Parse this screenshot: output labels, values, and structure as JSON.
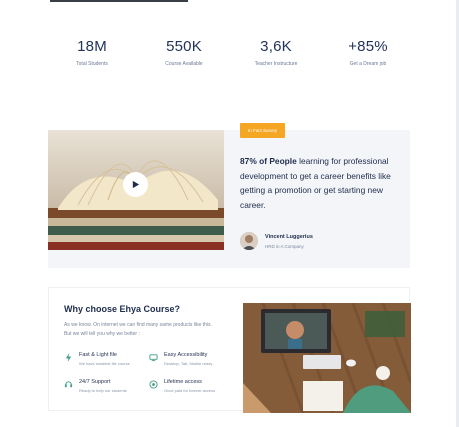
{
  "stats": [
    {
      "value": "18M",
      "label": "Total Students"
    },
    {
      "value": "550K",
      "label": "Course Available"
    },
    {
      "value": "3,6K",
      "label": "Teacher Instructure"
    },
    {
      "value": "+85%",
      "label": "Get a Dream job"
    }
  ],
  "survey": {
    "badge": "In Fact Survey",
    "highlight": "87% of People",
    "text": " learning for professional development to get a career benefits like getting a promotion or get starting new career.",
    "author_name": "Vincent Luggerius",
    "author_role": "HRD in A Company"
  },
  "why": {
    "title": "Why choose Ehya Course?",
    "description": "As we know. On internet we can find many same products like this. But we will tell you why we better :",
    "features": [
      {
        "title": "Fast & Light file",
        "sub": "We have smallest file course",
        "icon": "bolt-icon"
      },
      {
        "title": "Easy Accessibility",
        "sub": "Desktop, Tab, Mobile ready",
        "icon": "devices-icon"
      },
      {
        "title": "24/7 Support",
        "sub": "Ready to help our students",
        "icon": "headset-icon"
      },
      {
        "title": "Lifetime access",
        "sub": "Once paid for forever access",
        "icon": "infinity-icon"
      }
    ]
  },
  "colors": {
    "accent": "#f5a623",
    "text": "#1f2d4d",
    "feature_icon": "#3f9b86"
  }
}
